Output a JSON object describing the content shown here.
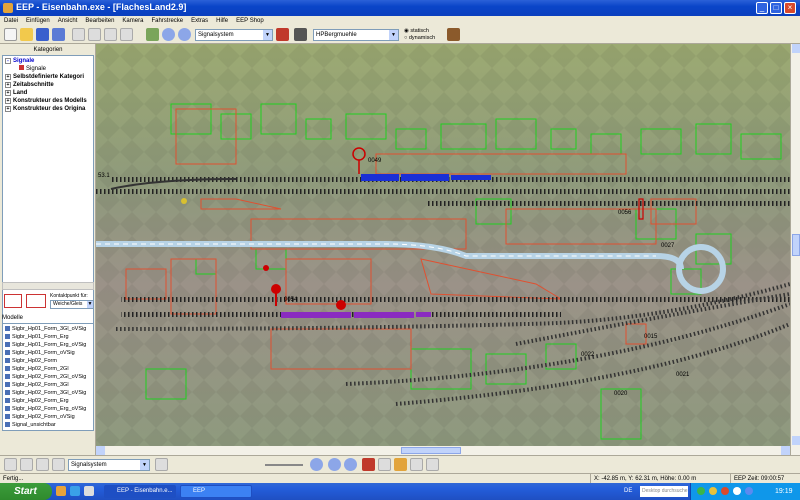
{
  "window": {
    "title": "EEP - Eisenbahn.exe - [FlachesLand2.9]",
    "buttons": [
      "_",
      "□",
      "×"
    ]
  },
  "menu": [
    "Datei",
    "Einfügen",
    "Ansicht",
    "Bearbeiten",
    "Kamera",
    "Fahrstrecke",
    "Extras",
    "Hilfe",
    "EEP Shop"
  ],
  "toolbar": {
    "layer_select": "Signalsystem",
    "object_select": "HPBergmuehle",
    "radio_static": "statisch",
    "radio_dynamic": "dynamisch"
  },
  "left_panel": {
    "categories_header": "Kategorien",
    "tree": [
      {
        "label": "Signale",
        "level": 0,
        "bold": true,
        "expander": "-"
      },
      {
        "label": "Signale",
        "level": 1,
        "bold": false,
        "expander": ""
      },
      {
        "label": "Selbstdefinierte Kategori",
        "level": 0,
        "bold": true,
        "expander": "+"
      },
      {
        "label": "Zeitabschnitte",
        "level": 0,
        "bold": true,
        "expander": "+"
      },
      {
        "label": "Land",
        "level": 0,
        "bold": true,
        "expander": "+"
      },
      {
        "label": "Konstrukteur des Modells",
        "level": 0,
        "bold": true,
        "expander": "+"
      },
      {
        "label": "Konstrukteur des Origina",
        "level": 0,
        "bold": true,
        "expander": "+"
      }
    ],
    "kontakt_label": "Kontaktpunkt für:",
    "kontakt_select": "Weiche/Gleis",
    "models_header": "Modelle",
    "models": [
      "Sigbr_Hp01_Form_3Gl_oVSig",
      "Sigbr_Hp01_Form_Erg",
      "Sigbr_Hp01_Form_Erg_oVSig",
      "Sigbr_Hp01_Form_oVSig",
      "Sigbr_Hp02_Form",
      "Sigbr_Hp02_Form_2Gl",
      "Sigbr_Hp02_Form_2Gl_oVSig",
      "Sigbr_Hp02_Form_3Gl",
      "Sigbr_Hp02_Form_3Gl_oVSig",
      "Sigbr_Hp02_Form_Erg",
      "Sigbr_Hp02_Form_Erg_oVSig",
      "Sigbr_Hp02_Form_oVSig",
      "Signal_unsichtbar"
    ]
  },
  "viewport": {
    "signal_labels": [
      "0049",
      "0054",
      "0056",
      "0027",
      "0022",
      "0021",
      "0020",
      "0015",
      "53.1"
    ]
  },
  "bottom_toolbar": {
    "layer_select": "Signalsystem"
  },
  "status": {
    "left": "Fertig...",
    "coords": "X: -42.85 m, Y: 62.31 m, Höhe: 0.00 m",
    "time": "EEP Zeit: 09:00:57"
  },
  "taskbar": {
    "start": "Start",
    "tasks": [
      "EEP - Eisenbahn.e...",
      "EEP"
    ],
    "lang": "DE",
    "search": "Desktop durchsuchen",
    "clock": "19:19"
  },
  "colors": {
    "titlebar": "#0A45C8",
    "tree_selected": "#0000CC",
    "train_blue": "#1A2FD6",
    "train_purple": "#8A2BC0",
    "signal_red": "#CC0000",
    "outline_green": "#20D020",
    "outline_red": "#E05030"
  }
}
